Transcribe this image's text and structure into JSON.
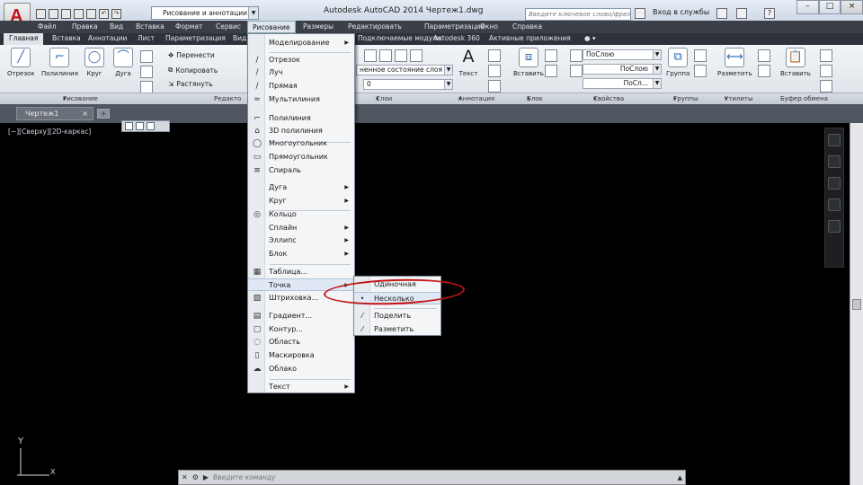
{
  "app": {
    "title": "Autodesk AutoCAD 2014    Чертеж1.dwg",
    "workspace": "Рисование и аннотации",
    "search_placeholder": "Введите ключевое слово/фразу",
    "signin": "Вход в службы"
  },
  "menubar": [
    "Файл",
    "Правка",
    "Вид",
    "Вставка",
    "Формат",
    "Сервис",
    "Рисование",
    "Размеры",
    "Редактировать",
    "Параметризация",
    "Окно",
    "Справка"
  ],
  "ribbon_tabs": [
    "Главная",
    "Вставка",
    "Аннотации",
    "Лист",
    "Параметризация",
    "Вид",
    "Подключаемые модули",
    "Autodesk 360",
    "Активные приложения"
  ],
  "ribbon": {
    "draw_tools": [
      "Отрезок",
      "Полилиния",
      "Круг",
      "Дуга"
    ],
    "modify_tools": [
      "Перенести",
      "Копировать",
      "Растянуть"
    ],
    "layer_state": "ненное состояние слоя",
    "layer_value": "0",
    "text": "Текст",
    "insert": "Вставить",
    "bylayer": "ПоСлою",
    "bylayer2": "ПоСлою",
    "bylayer3": "ПоСл...",
    "group": "Группа",
    "measure": "Разметить",
    "paste": "Вставить"
  },
  "panels": [
    "Рисование",
    "Редакто",
    "Слои",
    "Аннотация",
    "Блок",
    "Свойства",
    "Группы",
    "Утилиты",
    "Буфер обмена"
  ],
  "doc_tab": "Чертеж1",
  "viewport_label": "[−][Сверху][2D-каркас]",
  "ucs": {
    "x": "X",
    "y": "Y"
  },
  "command_placeholder": "Введите команду",
  "draw_menu": {
    "items": [
      {
        "label": "Моделирование",
        "icon": "",
        "sub": true
      },
      {
        "label": "Отрезок",
        "icon": "/",
        "sub": false
      },
      {
        "label": "Луч",
        "icon": "/",
        "sub": false
      },
      {
        "label": "Прямая",
        "icon": "/",
        "sub": false
      },
      {
        "label": "Мультилиния",
        "icon": "≈",
        "sub": false
      },
      {
        "label": "Полилиния",
        "icon": "⌐",
        "sub": false
      },
      {
        "label": "3D полилиния",
        "icon": "⌂",
        "sub": false
      },
      {
        "label": "Многоугольник",
        "icon": "◯",
        "sub": false
      },
      {
        "label": "Прямоугольник",
        "icon": "▭",
        "sub": false
      },
      {
        "label": "Спираль",
        "icon": "≡",
        "sub": false
      },
      {
        "label": "Дуга",
        "icon": "",
        "sub": true
      },
      {
        "label": "Круг",
        "icon": "",
        "sub": true
      },
      {
        "label": "Кольцо",
        "icon": "◎",
        "sub": false
      },
      {
        "label": "Сплайн",
        "icon": "",
        "sub": true
      },
      {
        "label": "Эллипс",
        "icon": "",
        "sub": true
      },
      {
        "label": "Блок",
        "icon": "",
        "sub": true
      },
      {
        "label": "Таблица...",
        "icon": "▦",
        "sub": false
      },
      {
        "label": "Точка",
        "icon": "",
        "sub": true
      },
      {
        "label": "Штриховка...",
        "icon": "▨",
        "sub": false
      },
      {
        "label": "Градиент...",
        "icon": "▤",
        "sub": false
      },
      {
        "label": "Контур...",
        "icon": "▢",
        "sub": false
      },
      {
        "label": "Область",
        "icon": "◌",
        "sub": false
      },
      {
        "label": "Маскировка",
        "icon": "▯",
        "sub": false
      },
      {
        "label": "Облако",
        "icon": "☁",
        "sub": false
      },
      {
        "label": "Текст",
        "icon": "",
        "sub": true
      }
    ]
  },
  "point_menu": {
    "items": [
      {
        "label": "Одиночная",
        "icon": ""
      },
      {
        "label": "Несколько",
        "icon": "•"
      },
      {
        "label": "Поделить",
        "icon": "⁄"
      },
      {
        "label": "Разметить",
        "icon": "⁄"
      }
    ]
  },
  "colors": {
    "highlight_ring": "#c31515",
    "canvas": "#000000"
  }
}
